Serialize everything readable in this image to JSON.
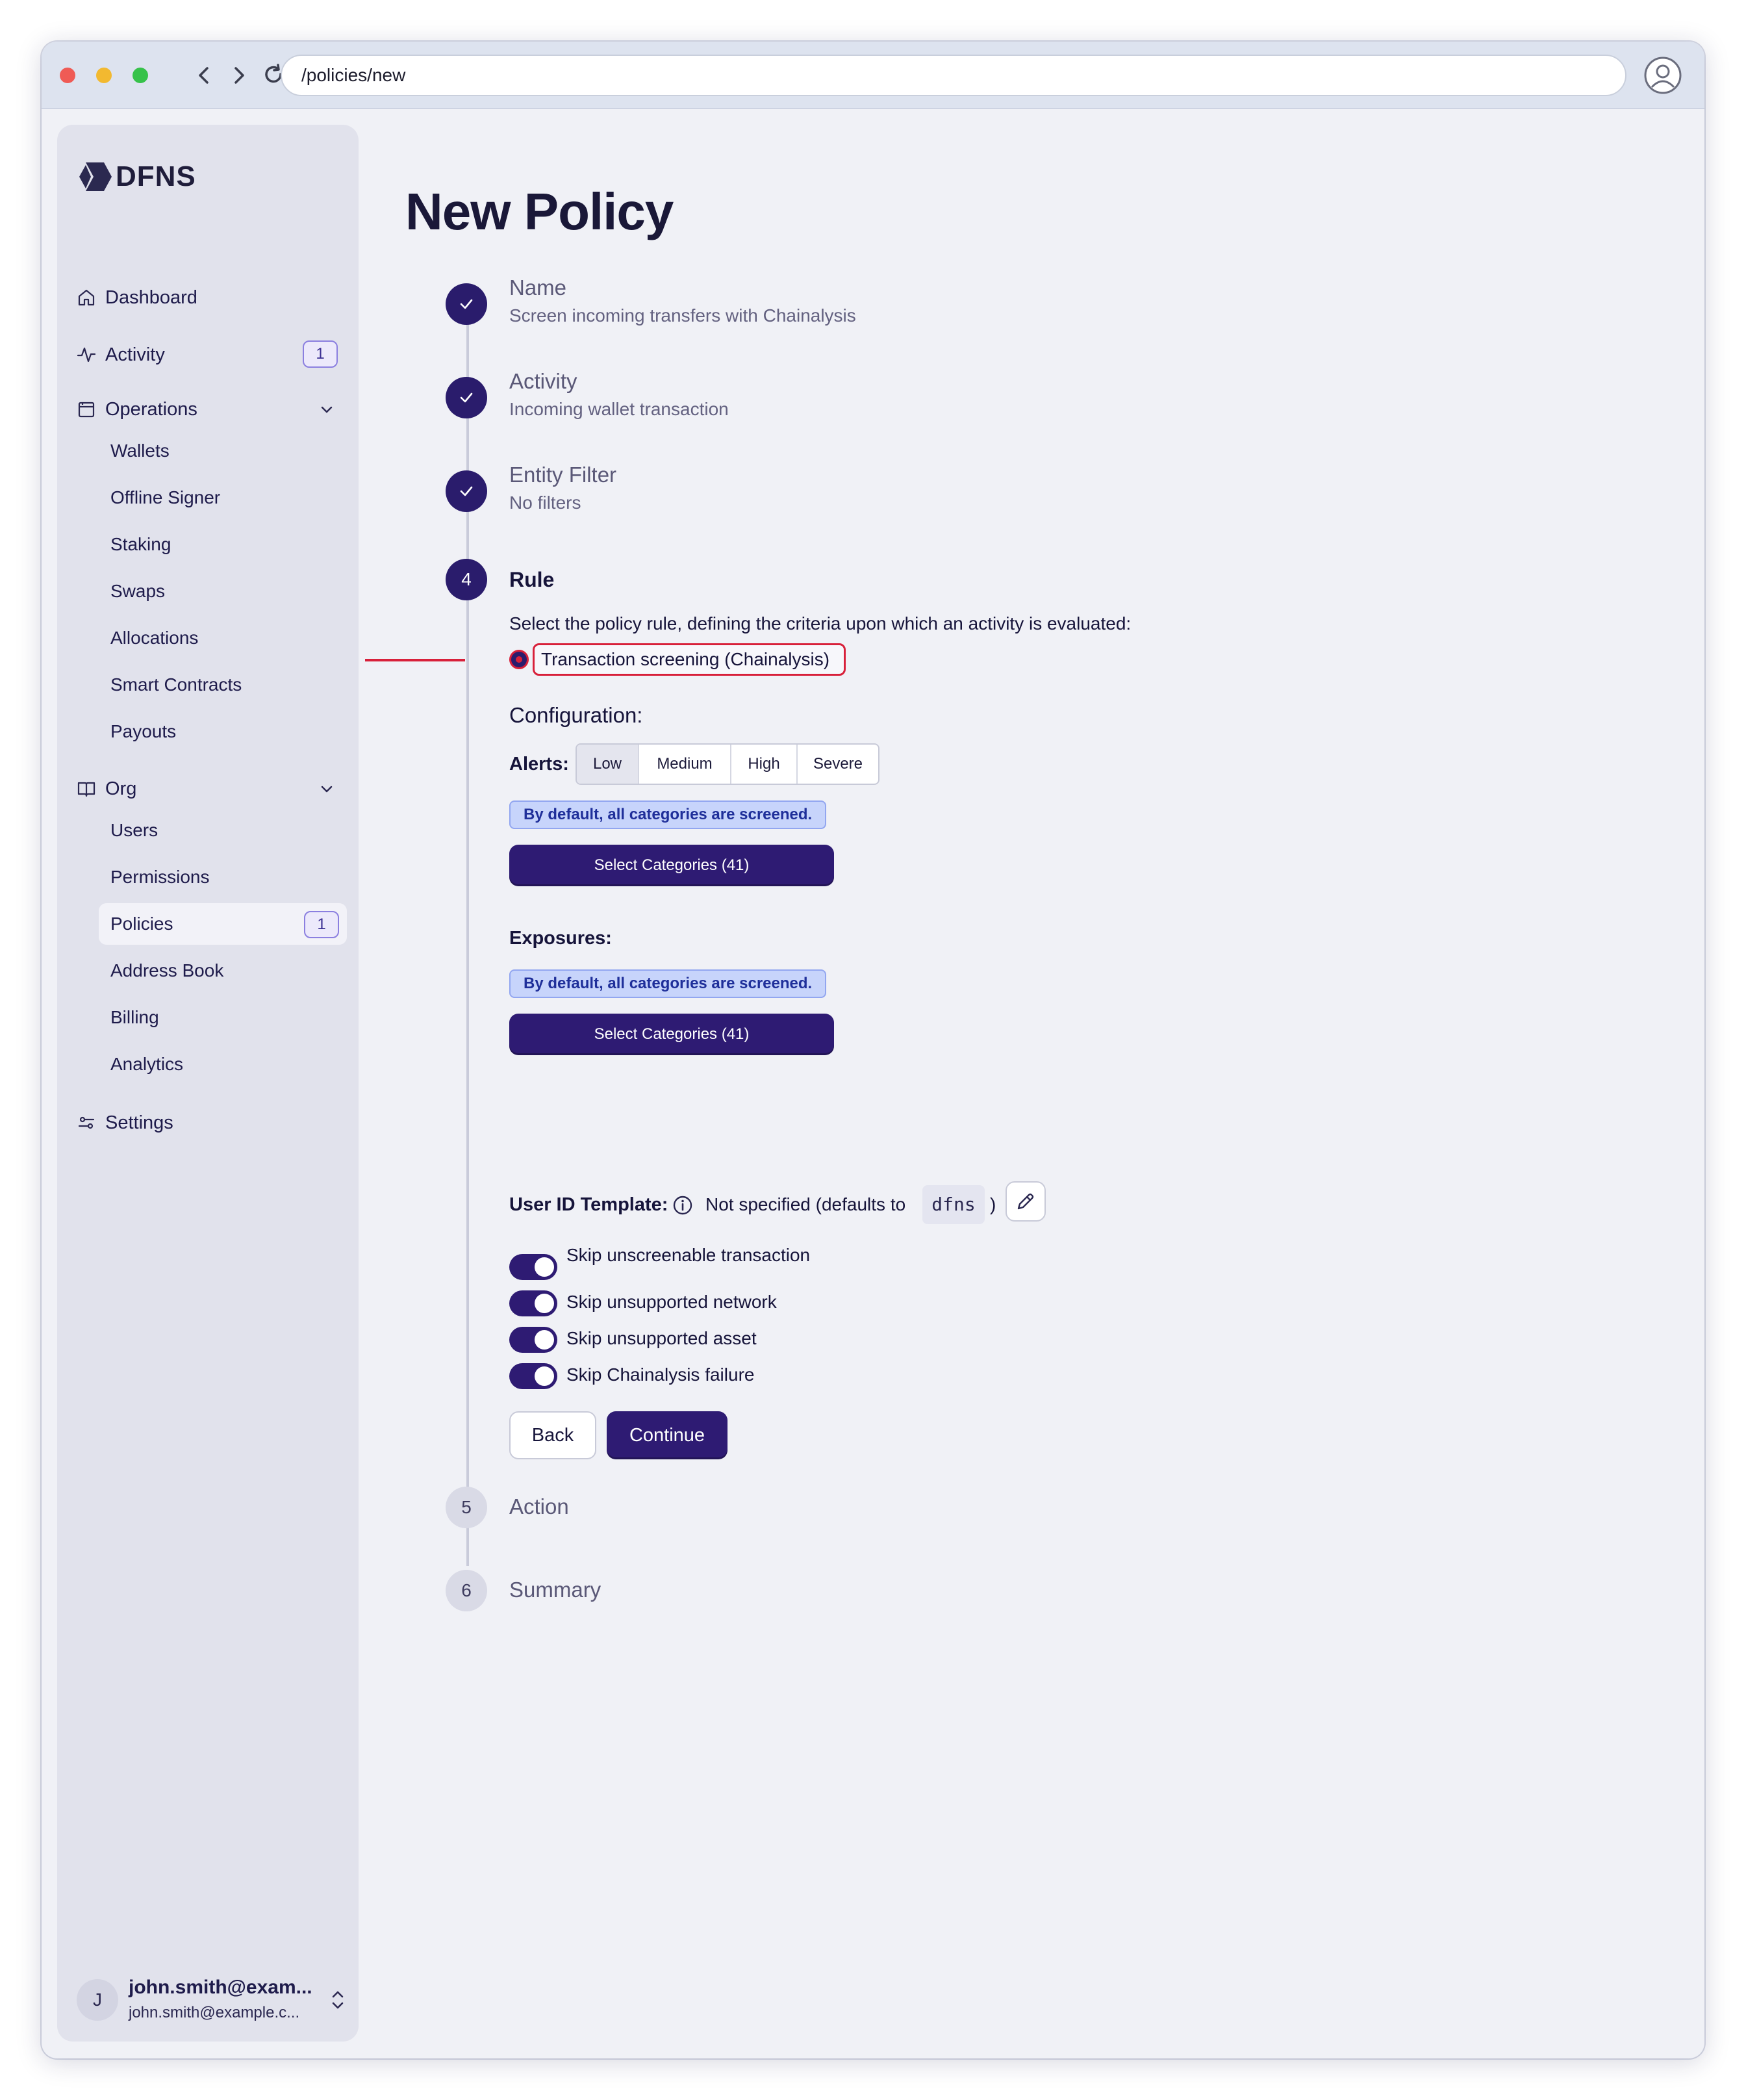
{
  "browser": {
    "url": "/policies/new"
  },
  "sidebar": {
    "logo_text": "DFNS",
    "dashboard": "Dashboard",
    "activity": {
      "label": "Activity",
      "badge": "1"
    },
    "operations": {
      "label": "Operations",
      "items": [
        "Wallets",
        "Offline Signer",
        "Staking",
        "Swaps",
        "Allocations",
        "Smart Contracts",
        "Payouts"
      ]
    },
    "org": {
      "label": "Org",
      "items": [
        "Users",
        "Permissions",
        "Policies",
        "Address Book",
        "Billing",
        "Analytics"
      ],
      "policies_badge": "1"
    },
    "settings": "Settings",
    "user": {
      "initial": "J",
      "name": "john.smith@exam...",
      "email": "john.smith@example.c..."
    }
  },
  "main": {
    "title": "New Policy",
    "steps": [
      {
        "title": "Name",
        "subtitle": "Screen incoming transfers with Chainalysis",
        "status": "complete"
      },
      {
        "title": "Activity",
        "subtitle": "Incoming wallet transaction",
        "status": "complete"
      },
      {
        "title": "Entity Filter",
        "subtitle": "No filters",
        "status": "complete"
      },
      {
        "number": "4",
        "title": "Rule",
        "status": "active"
      },
      {
        "number": "5",
        "title": "Action",
        "status": "pending"
      },
      {
        "number": "6",
        "title": "Summary",
        "status": "pending"
      }
    ],
    "rule": {
      "description": "Select the policy rule, defining the criteria upon which an activity is evaluated:",
      "selected_option": "Transaction screening (Chainalysis)",
      "configuration_title": "Configuration:",
      "alerts": {
        "label": "Alerts:",
        "levels": [
          "Low",
          "Medium",
          "High",
          "Severe"
        ],
        "selected": "Low",
        "info": "By default, all categories are screened.",
        "button": "Select Categories (41)"
      },
      "exposures": {
        "label": "Exposures:",
        "info": "By default, all categories are screened.",
        "button": "Select Categories (41)"
      },
      "user_id_template": {
        "label": "User ID Template:",
        "text": "Not specified (defaults to",
        "default_value": "dfns",
        "closing": ")"
      },
      "toggles": [
        {
          "label": "Skip unscreenable transaction",
          "on": true
        },
        {
          "label": "Skip unsupported network",
          "on": true
        },
        {
          "label": "Skip unsupported asset",
          "on": true
        },
        {
          "label": "Skip Chainalysis failure",
          "on": true
        }
      ],
      "back_label": "Back",
      "continue_label": "Continue"
    }
  },
  "colors": {
    "primary": "#2e1b73",
    "highlight": "#d8203a",
    "info_bg": "#c7d4fb",
    "info_text": "#1f2f9a"
  }
}
